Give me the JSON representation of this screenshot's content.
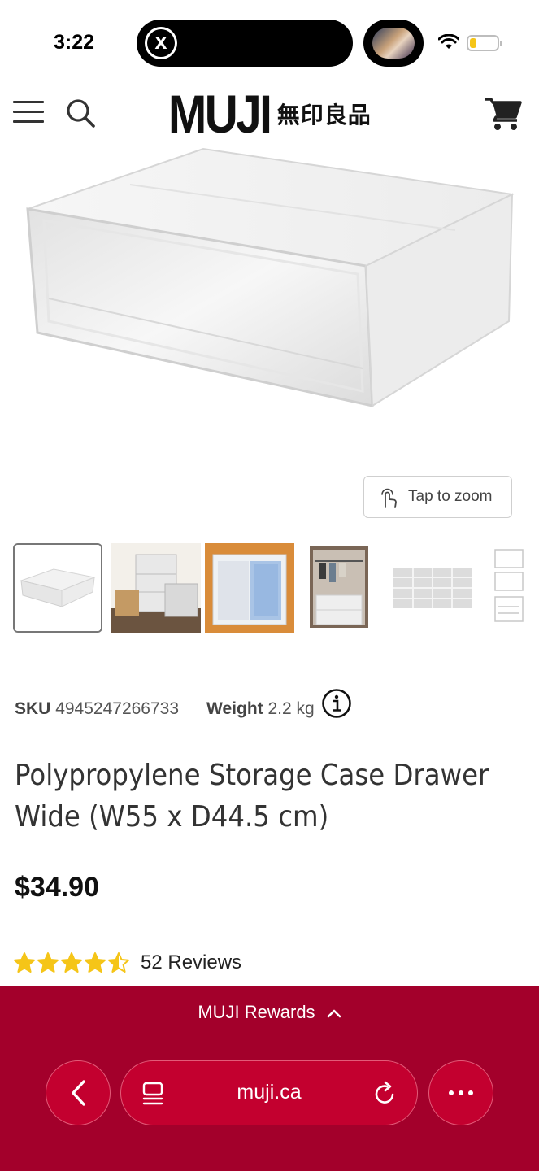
{
  "status_bar": {
    "time": "3:22",
    "island_app_glyph": "X",
    "icons": [
      "x-app-icon",
      "now-playing-thumbnail",
      "wifi-icon",
      "battery-icon"
    ],
    "battery_color": "#f5c518"
  },
  "header": {
    "logo_text": "MUJI",
    "logo_jp": "無印良品",
    "icons": [
      "menu-icon",
      "search-icon",
      "cart-icon"
    ]
  },
  "gallery": {
    "zoom_label": "Tap to zoom",
    "thumbnail_count": 6,
    "active_index": 0
  },
  "product": {
    "sku_label": "SKU",
    "sku": "4945247266733",
    "weight_label": "Weight",
    "weight": "2.2 kg",
    "title_line1": "Polypropylene Storage Case Drawer",
    "title_line2": "Wide (W55 x D44.5 cm)",
    "price": "$34.90",
    "rating": 4.5,
    "reviews": "52 Reviews",
    "star_color": "#f5c518"
  },
  "browser": {
    "rewards_label": "MUJI Rewards",
    "url": "muji.ca",
    "accent": "#a3002b"
  }
}
